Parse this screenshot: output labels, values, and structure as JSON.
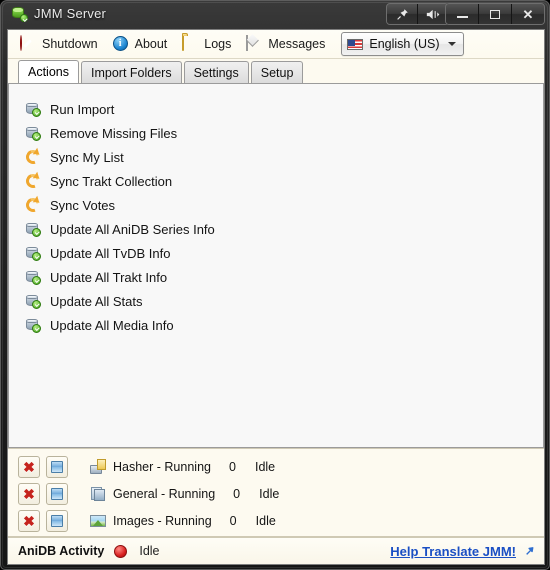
{
  "window": {
    "title": "JMM Server",
    "app_icon": "database-green-icon",
    "caption_buttons": [
      {
        "name": "pin-button",
        "icon": "pin-icon"
      },
      {
        "name": "volume-button",
        "icon": "volume-icon"
      },
      {
        "name": "minimize-button",
        "icon": "minimize-icon"
      },
      {
        "name": "maximize-button",
        "icon": "maximize-icon"
      },
      {
        "name": "close-button",
        "icon": "close-icon",
        "glyph": "✕"
      }
    ]
  },
  "toolbar": {
    "items": [
      {
        "label": "Shutdown",
        "icon": "shutdown-icon"
      },
      {
        "label": "About",
        "icon": "info-icon",
        "glyph": "i"
      },
      {
        "label": "Logs",
        "icon": "folder-icon"
      },
      {
        "label": "Messages",
        "icon": "envelope-icon"
      }
    ],
    "language": {
      "value": "English (US)",
      "icon": "us-flag-icon",
      "caret": "chevron-down-icon"
    }
  },
  "tabs": [
    {
      "label": "Actions",
      "active": true
    },
    {
      "label": "Import Folders",
      "active": false
    },
    {
      "label": "Settings",
      "active": false
    },
    {
      "label": "Setup",
      "active": false
    }
  ],
  "actions": [
    {
      "label": "Run Import",
      "icon": "database-check-icon"
    },
    {
      "label": "Remove Missing Files",
      "icon": "database-check-icon"
    },
    {
      "label": "Sync My List",
      "icon": "sync-icon"
    },
    {
      "label": "Sync Trakt Collection",
      "icon": "sync-icon"
    },
    {
      "label": "Sync Votes",
      "icon": "sync-icon"
    },
    {
      "label": "Update All AniDB Series Info",
      "icon": "database-check-icon"
    },
    {
      "label": "Update All TvDB Info",
      "icon": "database-check-icon"
    },
    {
      "label": "Update All Trakt Info",
      "icon": "database-check-icon"
    },
    {
      "label": "Update All Stats",
      "icon": "database-check-icon"
    },
    {
      "label": "Update All Media Info",
      "icon": "database-check-icon"
    }
  ],
  "queue": {
    "rows": [
      {
        "name": "Hasher - Running",
        "count": "0",
        "state": "Idle",
        "icon": "hasher-icon",
        "stop_icon": "x-icon",
        "pause_icon": "pause-icon"
      },
      {
        "name": "General - Running",
        "count": "0",
        "state": "Idle",
        "icon": "general-icon",
        "stop_icon": "x-icon",
        "pause_icon": "pause-icon"
      },
      {
        "name": "Images - Running",
        "count": "0",
        "state": "Idle",
        "icon": "images-icon",
        "stop_icon": "x-icon",
        "pause_icon": "pause-icon"
      }
    ]
  },
  "statusbar": {
    "label": "AniDB Activity",
    "led": "red-status-led",
    "led_color": "#d81f1f",
    "state": "Idle",
    "help_link": "Help Translate JMM!",
    "help_icon": "external-link-arrow-icon"
  },
  "colors": {
    "titlebar": "#2a2a2a",
    "toolbar_bg": "#fdfaf0",
    "panel_bg": "#f8f8f8",
    "queue_bg": "#fdfaf0",
    "link": "#1a4fc4",
    "accent_green": "#4d9a1f",
    "accent_orange": "#f0a72e"
  }
}
